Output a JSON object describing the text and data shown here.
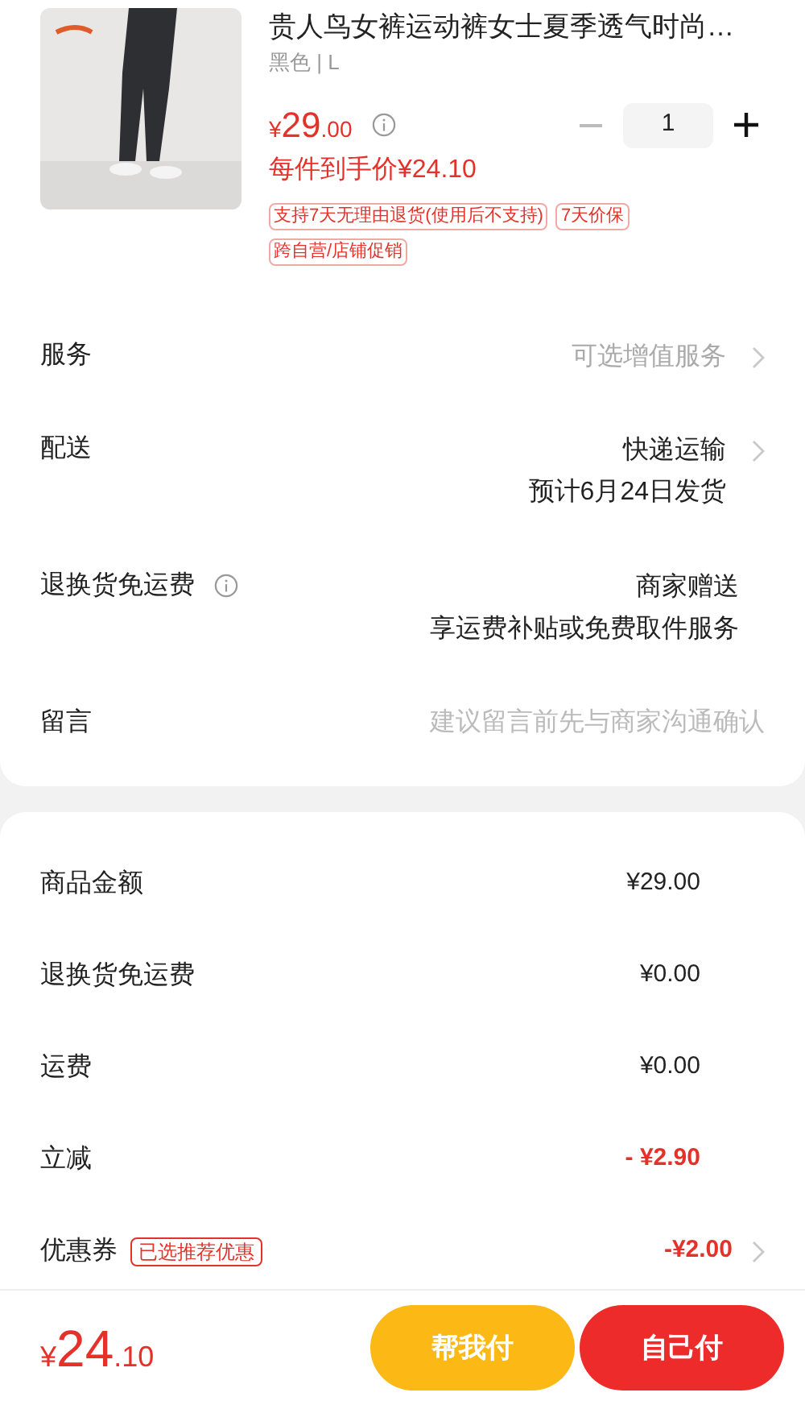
{
  "product": {
    "title": "贵人鸟女裤运动裤女士夏季透气时尚…",
    "variant": "黑色 | L",
    "price_symbol": "¥",
    "price_int": "29",
    "price_dec": ".00",
    "quantity": "1",
    "final_price": "每件到手价¥24.10",
    "tags": [
      "支持7天无理由退货(使用后不支持)",
      "7天价保",
      "跨自营/店铺促销"
    ]
  },
  "options": [
    {
      "label": "服务",
      "lines": [
        "可选增值服务"
      ],
      "muted": true,
      "chevron": true,
      "info": false
    },
    {
      "label": "配送",
      "lines": [
        "快递运输",
        "预计6月24日发货"
      ],
      "muted": false,
      "chevron": true,
      "info": false
    },
    {
      "label": "退换货免运费",
      "lines": [
        "商家赠送",
        "享运费补贴或免费取件服务"
      ],
      "muted": false,
      "chevron": false,
      "info": true
    }
  ],
  "note": {
    "label": "留言",
    "placeholder": "建议留言前先与商家沟通确认"
  },
  "summary": [
    {
      "label": "商品金额",
      "value": "¥29.00",
      "highlight": false
    },
    {
      "label": "退换货免运费",
      "value": "¥0.00",
      "highlight": false
    },
    {
      "label": "运费",
      "value": "¥0.00",
      "highlight": false
    },
    {
      "label": "立减",
      "value": "- ¥2.90",
      "highlight": true
    },
    {
      "label": "优惠券",
      "tag": "已选推荐优惠",
      "value": "-¥2.00",
      "highlight": true,
      "chevron": true
    }
  ],
  "footer": {
    "symbol": "¥",
    "int": "24",
    "dec": ".10",
    "buttons": [
      {
        "label": "帮我付",
        "kind": "secondary"
      },
      {
        "label": "自己付",
        "kind": "primary"
      }
    ]
  }
}
